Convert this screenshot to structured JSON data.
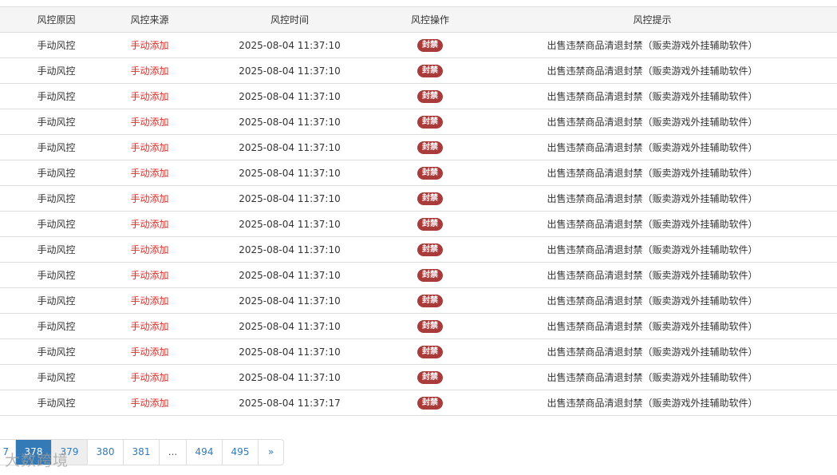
{
  "table": {
    "headers": {
      "reason": "风控原因",
      "source": "风控来源",
      "time": "风控时间",
      "action": "风控操作",
      "hint": "风控提示"
    },
    "rows": [
      {
        "reason": "手动风控",
        "source": "手动添加",
        "time": "2025-08-04 11:37:10",
        "action": "封禁",
        "hint": "出售违禁商品清退封禁（贩卖游戏外挂辅助软件）"
      },
      {
        "reason": "手动风控",
        "source": "手动添加",
        "time": "2025-08-04 11:37:10",
        "action": "封禁",
        "hint": "出售违禁商品清退封禁（贩卖游戏外挂辅助软件）"
      },
      {
        "reason": "手动风控",
        "source": "手动添加",
        "time": "2025-08-04 11:37:10",
        "action": "封禁",
        "hint": "出售违禁商品清退封禁（贩卖游戏外挂辅助软件）"
      },
      {
        "reason": "手动风控",
        "source": "手动添加",
        "time": "2025-08-04 11:37:10",
        "action": "封禁",
        "hint": "出售违禁商品清退封禁（贩卖游戏外挂辅助软件）"
      },
      {
        "reason": "手动风控",
        "source": "手动添加",
        "time": "2025-08-04 11:37:10",
        "action": "封禁",
        "hint": "出售违禁商品清退封禁（贩卖游戏外挂辅助软件）"
      },
      {
        "reason": "手动风控",
        "source": "手动添加",
        "time": "2025-08-04 11:37:10",
        "action": "封禁",
        "hint": "出售违禁商品清退封禁（贩卖游戏外挂辅助软件）"
      },
      {
        "reason": "手动风控",
        "source": "手动添加",
        "time": "2025-08-04 11:37:10",
        "action": "封禁",
        "hint": "出售违禁商品清退封禁（贩卖游戏外挂辅助软件）"
      },
      {
        "reason": "手动风控",
        "source": "手动添加",
        "time": "2025-08-04 11:37:10",
        "action": "封禁",
        "hint": "出售违禁商品清退封禁（贩卖游戏外挂辅助软件）"
      },
      {
        "reason": "手动风控",
        "source": "手动添加",
        "time": "2025-08-04 11:37:10",
        "action": "封禁",
        "hint": "出售违禁商品清退封禁（贩卖游戏外挂辅助软件）"
      },
      {
        "reason": "手动风控",
        "source": "手动添加",
        "time": "2025-08-04 11:37:10",
        "action": "封禁",
        "hint": "出售违禁商品清退封禁（贩卖游戏外挂辅助软件）"
      },
      {
        "reason": "手动风控",
        "source": "手动添加",
        "time": "2025-08-04 11:37:10",
        "action": "封禁",
        "hint": "出售违禁商品清退封禁（贩卖游戏外挂辅助软件）"
      },
      {
        "reason": "手动风控",
        "source": "手动添加",
        "time": "2025-08-04 11:37:10",
        "action": "封禁",
        "hint": "出售违禁商品清退封禁（贩卖游戏外挂辅助软件）"
      },
      {
        "reason": "手动风控",
        "source": "手动添加",
        "time": "2025-08-04 11:37:10",
        "action": "封禁",
        "hint": "出售违禁商品清退封禁（贩卖游戏外挂辅助软件）"
      },
      {
        "reason": "手动风控",
        "source": "手动添加",
        "time": "2025-08-04 11:37:10",
        "action": "封禁",
        "hint": "出售违禁商品清退封禁（贩卖游戏外挂辅助软件）"
      },
      {
        "reason": "手动风控",
        "source": "手动添加",
        "time": "2025-08-04 11:37:17",
        "action": "封禁",
        "hint": "出售违禁商品清退封禁（贩卖游戏外挂辅助软件）"
      }
    ]
  },
  "pagination": {
    "pages": [
      "7",
      "378",
      "379",
      "380",
      "381",
      "...",
      "494",
      "495",
      "»"
    ],
    "active": "378",
    "hovered": "379"
  },
  "watermark": "大数跨境",
  "colors": {
    "source_text": "#d9302b",
    "badge_bg": "#a93c3b",
    "pager_active": "#337ab7",
    "link": "#337ab7"
  }
}
